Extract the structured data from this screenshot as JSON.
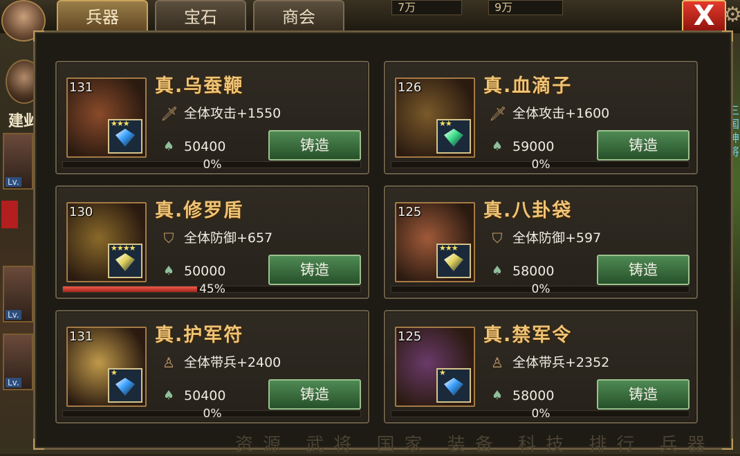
{
  "tabs": [
    {
      "label": "兵器",
      "active": true
    },
    {
      "label": "宝石",
      "active": false
    },
    {
      "label": "商会",
      "active": false
    }
  ],
  "top_resources": [
    "7万",
    "9万"
  ],
  "side_label": "建邺",
  "close_label": "X",
  "forge_label": "铸造",
  "cards": [
    {
      "level": "131",
      "name": "真.乌蚕鞭",
      "stat": "全体攻击+1550",
      "stat_icon": "sword-icon",
      "cost": "50400",
      "progress_pct": 0,
      "progress_label": "0%",
      "gem_stars": "★★★",
      "gem_color": "#3aa0ff",
      "art_color": "#8a4a2a"
    },
    {
      "level": "126",
      "name": "真.血滴子",
      "stat": "全体攻击+1600",
      "stat_icon": "sword-icon",
      "cost": "59000",
      "progress_pct": 0,
      "progress_label": "0%",
      "gem_stars": "★★",
      "gem_color": "#3ee08a",
      "art_color": "#7a5a2a"
    },
    {
      "level": "130",
      "name": "真.修罗盾",
      "stat": "全体防御+657",
      "stat_icon": "shield-icon",
      "cost": "50000",
      "progress_pct": 45,
      "progress_label": "45%",
      "gem_stars": "★★★★",
      "gem_color": "#e0d25a",
      "art_color": "#8a6a2a"
    },
    {
      "level": "125",
      "name": "真.八卦袋",
      "stat": "全体防御+597",
      "stat_icon": "shield-icon",
      "cost": "58000",
      "progress_pct": 0,
      "progress_label": "0%",
      "gem_stars": "★★★",
      "gem_color": "#e0d25a",
      "art_color": "#a05a3a"
    },
    {
      "level": "131",
      "name": "真.护军符",
      "stat": "全体带兵+2400",
      "stat_icon": "troop-icon",
      "cost": "50400",
      "progress_pct": 0,
      "progress_label": "0%",
      "gem_stars": "★",
      "gem_color": "#3aa0ff",
      "art_color": "#c09a4a"
    },
    {
      "level": "125",
      "name": "真.禁军令",
      "stat": "全体带兵+2352",
      "stat_icon": "troop-icon",
      "cost": "58000",
      "progress_pct": 0,
      "progress_label": "0%",
      "gem_stars": "★",
      "gem_color": "#3aa0ff",
      "art_color": "#6a3a6a"
    }
  ],
  "bottom_nav_ghost": "资源 武将 国家 装备 科技 排行 兵器"
}
